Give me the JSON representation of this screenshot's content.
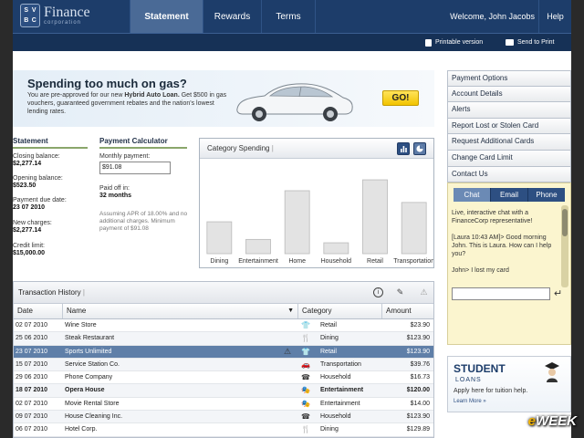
{
  "brand": {
    "logo_letters": [
      "S",
      "V",
      "B",
      "C"
    ],
    "name": "Finance",
    "sub": "corporation"
  },
  "nav": {
    "tabs": [
      {
        "label": "Statement"
      },
      {
        "label": "Rewards"
      },
      {
        "label": "Terms"
      }
    ],
    "welcome": "Welcome, John Jacobs",
    "help": "Help",
    "printable": "Printable version",
    "send_print": "Send to Print"
  },
  "ad": {
    "title": "Spending too much on gas?",
    "body_pre": "You are pre-approved for our new ",
    "body_bold": "Hybrid Auto Loan.",
    "body_post": " Get $500 in gas vouchers, guaranteed government rebates and the nation's lowest lending rates.",
    "go": "GO!"
  },
  "statement": {
    "title": "Statement",
    "items": [
      {
        "label": "Closing balance:",
        "value": "$2,277.14"
      },
      {
        "label": "Opening balance:",
        "value": "$523.50"
      },
      {
        "label": "Payment due date:",
        "value": "23 07 2010"
      },
      {
        "label": "New charges:",
        "value": "$2,277.14"
      },
      {
        "label": "Credit limit:",
        "value": "$15,000.00"
      }
    ]
  },
  "calculator": {
    "title": "Payment Calculator",
    "monthly_label": "Monthly payment:",
    "monthly_value": "$91.08",
    "paid_label": "Paid off in:",
    "paid_value": "32 months",
    "note": "Assuming APR of 18.00% and no additional charges. Minimum payment of $91.08"
  },
  "chart_data": {
    "type": "bar",
    "title": "Category Spending",
    "categories": [
      "Dining",
      "Entertainment",
      "Home",
      "Household",
      "Retail",
      "Transportation"
    ],
    "values": [
      38,
      17,
      75,
      13,
      88,
      61
    ],
    "ylim": [
      0,
      100
    ],
    "grid": false
  },
  "transactions": {
    "title": "Transaction History",
    "columns": [
      "Date",
      "Name",
      "Category",
      "Amount"
    ],
    "rows": [
      {
        "date": "02 07 2010",
        "name": "Wine Store",
        "category": "Retail",
        "amount": "$23.90",
        "icon": "shirt-icon"
      },
      {
        "date": "25 06 2010",
        "name": "Steak Restaurant",
        "category": "Dining",
        "amount": "$123.90",
        "icon": "fork-knife-icon"
      },
      {
        "date": "23 07 2010",
        "name": "Sports Unlimited",
        "category": "Retail",
        "amount": "$123.90",
        "icon": "shirt-icon",
        "selected": true
      },
      {
        "date": "15 07 2010",
        "name": "Service Station Co.",
        "category": "Transportation",
        "amount": "$39.76",
        "icon": "car-icon"
      },
      {
        "date": "29 06 2010",
        "name": "Phone Company",
        "category": "Household",
        "amount": "$16.73",
        "icon": "phone-icon"
      },
      {
        "date": "18 07 2010",
        "name": "Opera House",
        "category": "Entertainment",
        "amount": "$120.00",
        "icon": "masks-icon",
        "bold": true
      },
      {
        "date": "02 07 2010",
        "name": "Movie Rental Store",
        "category": "Entertainment",
        "amount": "$14.00",
        "icon": "masks-icon"
      },
      {
        "date": "09 07 2010",
        "name": "House Cleaning Inc.",
        "category": "Household",
        "amount": "$123.90",
        "icon": "phone-icon"
      },
      {
        "date": "06 07 2010",
        "name": "Hotel Corp.",
        "category": "Dining",
        "amount": "$129.89",
        "icon": "fork-knife-icon"
      }
    ]
  },
  "menu": [
    "Payment Options",
    "Account Details",
    "Alerts",
    "Report Lost or Stolen Card",
    "Request Additional Cards",
    "Change Card Limit",
    "Contact Us"
  ],
  "chat": {
    "tabs": [
      "Chat",
      "Email",
      "Phone"
    ],
    "messages": [
      "Live, interactive chat with a FinanceCorp representative!",
      "[Laura 10:43 AM]> Good morning John.  This is Laura.  How can I help you?",
      "John> I lost my card"
    ]
  },
  "student": {
    "title": "STUDENT",
    "sub": "LOANS",
    "apply": "Apply here for tuition help.",
    "more": "Learn More »"
  },
  "watermark": {
    "e": "e",
    "rest": "WEEK"
  },
  "colors": {
    "header": "#1d3d6a",
    "accent_green": "#8aa66b",
    "selected_row": "#5f7fa8",
    "chat_bg": "#fbf5cf"
  }
}
